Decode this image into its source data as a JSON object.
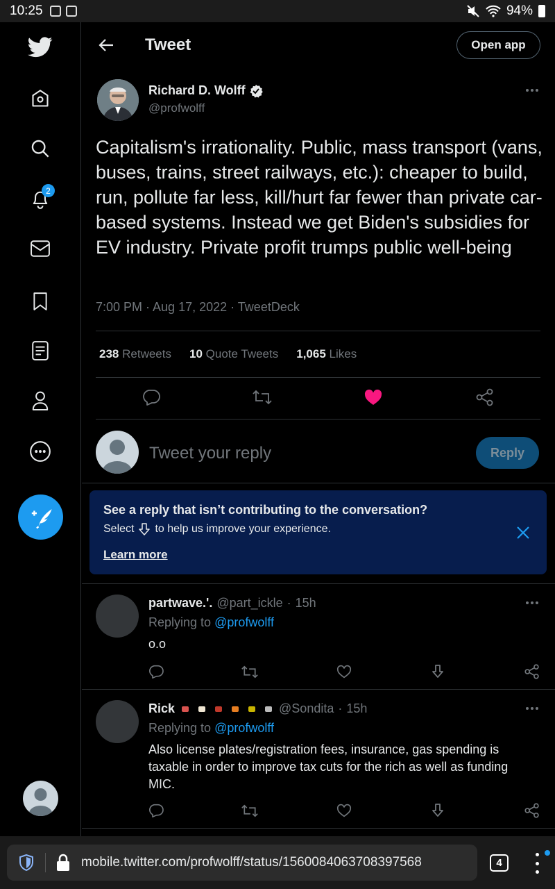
{
  "status_bar": {
    "time": "10:25",
    "battery": "94%"
  },
  "header": {
    "title": "Tweet",
    "open_app": "Open app"
  },
  "nav": {
    "notification_count": "2"
  },
  "tweet": {
    "author_name": "Richard D. Wolff",
    "author_handle": "@profwolff",
    "text": "Capitalism's irrationality. Public, mass transport (vans, buses, trains, street railways, etc.): cheaper to build, run, pollute far less, kill/hurt far fewer than private car-based systems. Instead we get Biden's subsidies for EV industry. Private profit trumps public well-being",
    "meta": "7:00 PM · Aug 17, 2022 · TweetDeck",
    "stats": {
      "retweets_count": "238",
      "retweets_label": "Retweets",
      "quotes_count": "10",
      "quotes_label": "Quote Tweets",
      "likes_count": "1,065",
      "likes_label": "Likes"
    }
  },
  "reply_box": {
    "placeholder": "Tweet your reply",
    "button": "Reply"
  },
  "notice": {
    "title": "See a reply that isn’t contributing to the conversation?",
    "body_before": "Select",
    "body_after": "to help us improve your experience.",
    "link": "Learn more"
  },
  "replies": [
    {
      "name": "partwave.'.",
      "handle": "@part_ickle",
      "time": "15h",
      "replying_label": "Replying to",
      "replying_to": "@profwolff",
      "text": "o.o"
    },
    {
      "name": "Rick",
      "handle": "@Sondita",
      "time": "15h",
      "replying_label": "Replying to",
      "replying_to": "@profwolff",
      "text": "Also license plates/registration fees, insurance, gas spending is taxable in order to improve tax cuts for the rich as well as funding MIC."
    }
  ],
  "browser": {
    "url": "mobile.twitter.com/profwolff/status/1560084063708397568",
    "tab_count": "4"
  },
  "colors": {
    "accent": "#1d9bf0",
    "like": "#f91880",
    "notice_bg": "#071d4d"
  }
}
